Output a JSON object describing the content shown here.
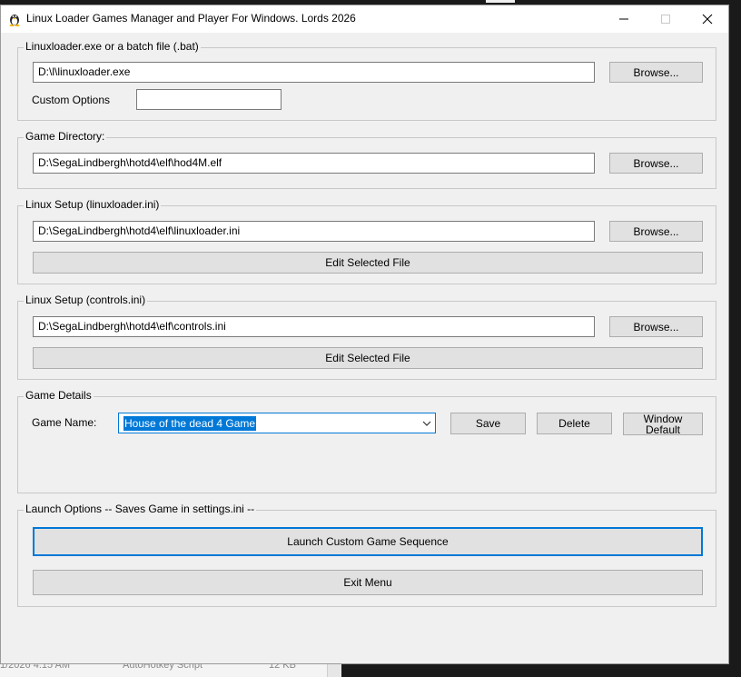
{
  "window": {
    "title": "Linux Loader Games Manager and Player For Windows.  Lords 2026"
  },
  "loader": {
    "legend": "Linuxloader.exe or a batch file (.bat)",
    "path": "D:\\l\\linuxloader.exe",
    "browse_label": "Browse...",
    "custom_options_label": "Custom Options",
    "custom_options_value": ""
  },
  "game_directory": {
    "legend": "Game Directory:",
    "path": "D:\\SegaLindbergh\\hotd4\\elf\\hod4M.elf",
    "browse_label": "Browse..."
  },
  "linux_setup": {
    "legend": "Linux Setup (linuxloader.ini)",
    "path": "D:\\SegaLindbergh\\hotd4\\elf\\linuxloader.ini",
    "browse_label": "Browse...",
    "edit_label": "Edit Selected File"
  },
  "controls_setup": {
    "legend": "Linux Setup (controls.ini)",
    "path": "D:\\SegaLindbergh\\hotd4\\elf\\controls.ini",
    "browse_label": "Browse...",
    "edit_label": "Edit Selected File"
  },
  "game_details": {
    "legend": "Game Details",
    "game_name_label": "Game Name:",
    "selected_game": "House of the dead 4 Game",
    "save_label": "Save",
    "delete_label": "Delete",
    "window_default_line1": "Window",
    "window_default_line2": "Default"
  },
  "launch": {
    "legend": "Launch Options -- Saves Game in settings.ini --",
    "launch_label": "Launch Custom Game Sequence",
    "exit_label": "Exit Menu"
  },
  "background": {
    "row_time": "1/2026 4:15 AM",
    "row_type": "AutoHotkey Script",
    "row_size": "12 KB"
  },
  "colors": {
    "accent": "#0078d7",
    "window_bg": "#f0f0f0",
    "button_bg": "#e1e1e1"
  }
}
